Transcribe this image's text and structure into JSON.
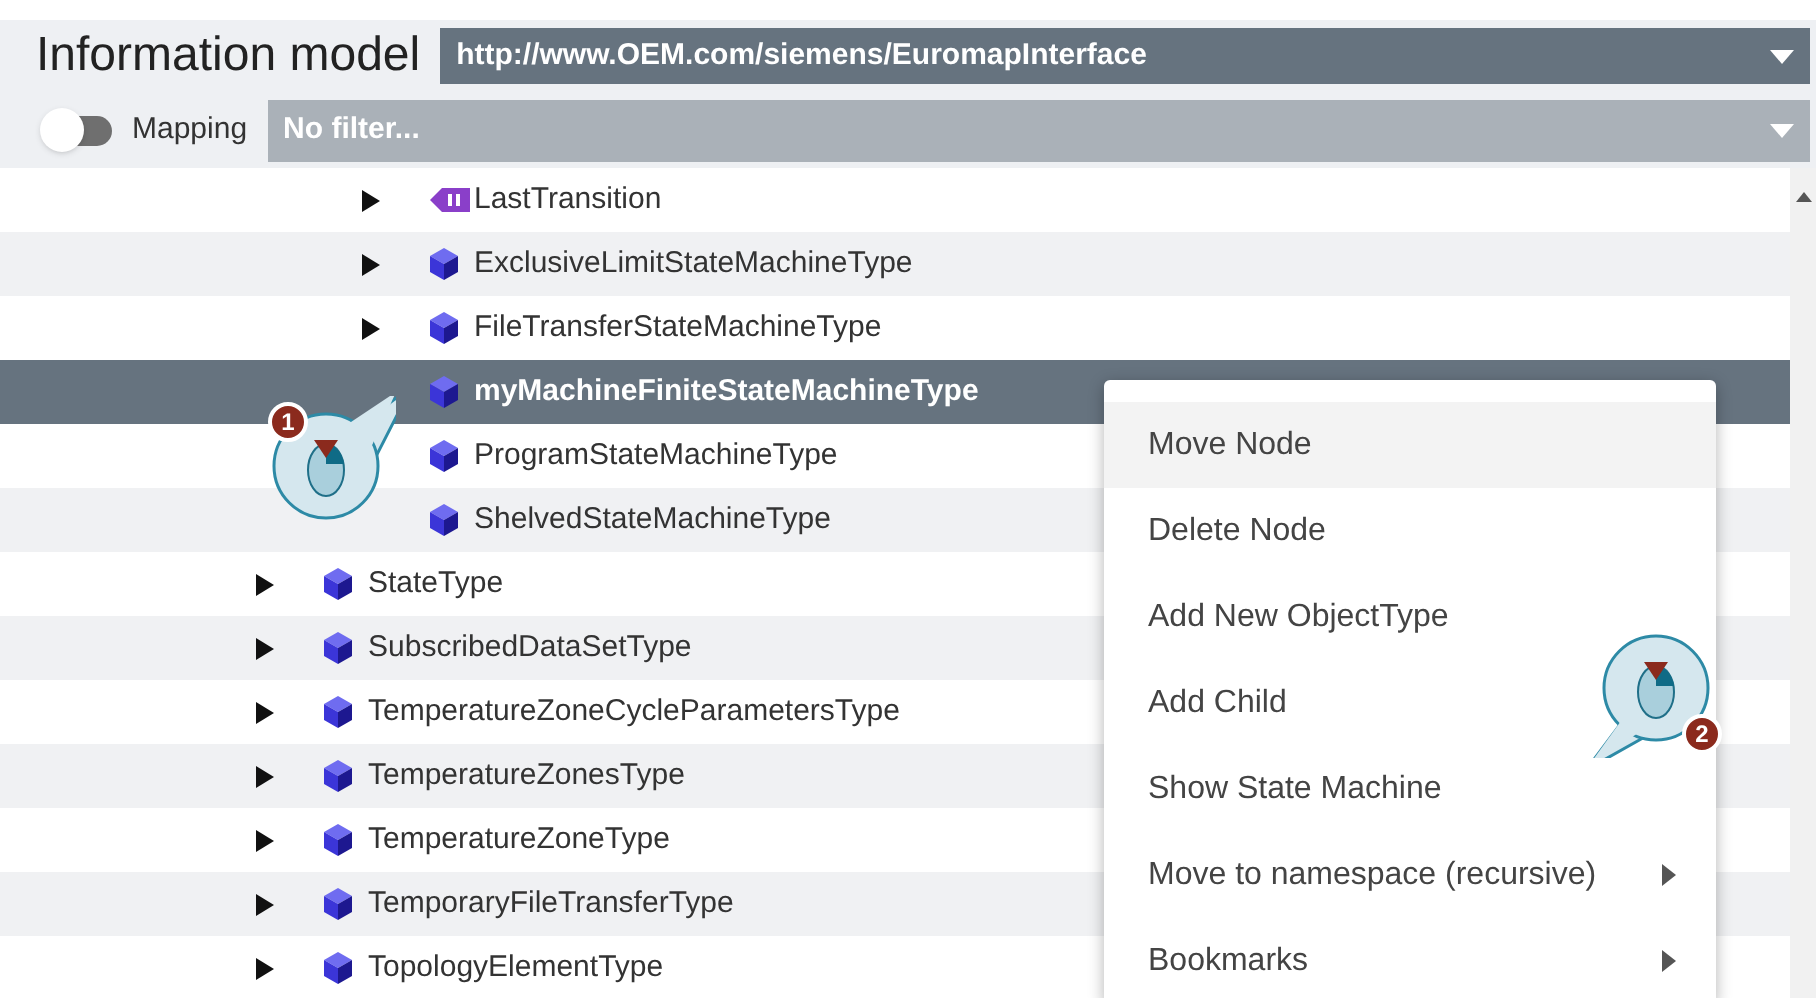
{
  "header": {
    "title": "Information model",
    "namespace": {
      "value": "http://www.OEM.com/siemens/EuromapInterface"
    },
    "mapping": {
      "label": "Mapping",
      "on": false
    },
    "filter": {
      "placeholder": "No filter..."
    }
  },
  "tree": {
    "items": [
      {
        "children": [
          {
            "label": "LastTransition",
            "kind": "variable",
            "expandable": true,
            "selected": false
          },
          {
            "label": "ExclusiveLimitStateMachineType",
            "kind": "object_type",
            "expandable": true,
            "selected": false
          },
          {
            "label": "FileTransferStateMachineType",
            "kind": "object_type",
            "expandable": true,
            "selected": false
          },
          {
            "label": "myMachineFiniteStateMachineType",
            "kind": "object_type",
            "expandable": false,
            "selected": true
          },
          {
            "label": "ProgramStateMachineType",
            "kind": "object_type",
            "expandable": false,
            "selected": false
          },
          {
            "label": "ShelvedStateMachineType",
            "kind": "object_type",
            "expandable": false,
            "selected": false
          }
        ]
      },
      {
        "label": "StateType",
        "kind": "object_type",
        "expandable": true,
        "selected": false
      },
      {
        "label": "SubscribedDataSetType",
        "kind": "object_type",
        "expandable": true,
        "selected": false
      },
      {
        "label": "TemperatureZoneCycleParametersType",
        "kind": "object_type",
        "expandable": true,
        "selected": false
      },
      {
        "label": "TemperatureZonesType",
        "kind": "object_type",
        "expandable": true,
        "selected": false
      },
      {
        "label": "TemperatureZoneType",
        "kind": "object_type",
        "expandable": true,
        "selected": false
      },
      {
        "label": "TemporaryFileTransferType",
        "kind": "object_type",
        "expandable": true,
        "selected": false
      },
      {
        "label": "TopologyElementType",
        "kind": "object_type",
        "expandable": true,
        "selected": false
      }
    ]
  },
  "context_menu": {
    "items": [
      {
        "label": "Move Node",
        "highlighted": true,
        "submenu": false
      },
      {
        "label": "Delete Node",
        "highlighted": false,
        "submenu": false
      },
      {
        "label": "Add New ObjectType",
        "highlighted": false,
        "submenu": false
      },
      {
        "label": "Add Child",
        "highlighted": false,
        "submenu": false
      },
      {
        "label": "Show State Machine",
        "highlighted": false,
        "submenu": false
      },
      {
        "label": "Move to namespace (recursive)",
        "highlighted": false,
        "submenu": true
      },
      {
        "label": "Bookmarks",
        "highlighted": false,
        "submenu": true
      }
    ]
  },
  "callouts": [
    {
      "number": "1"
    },
    {
      "number": "2"
    }
  ]
}
